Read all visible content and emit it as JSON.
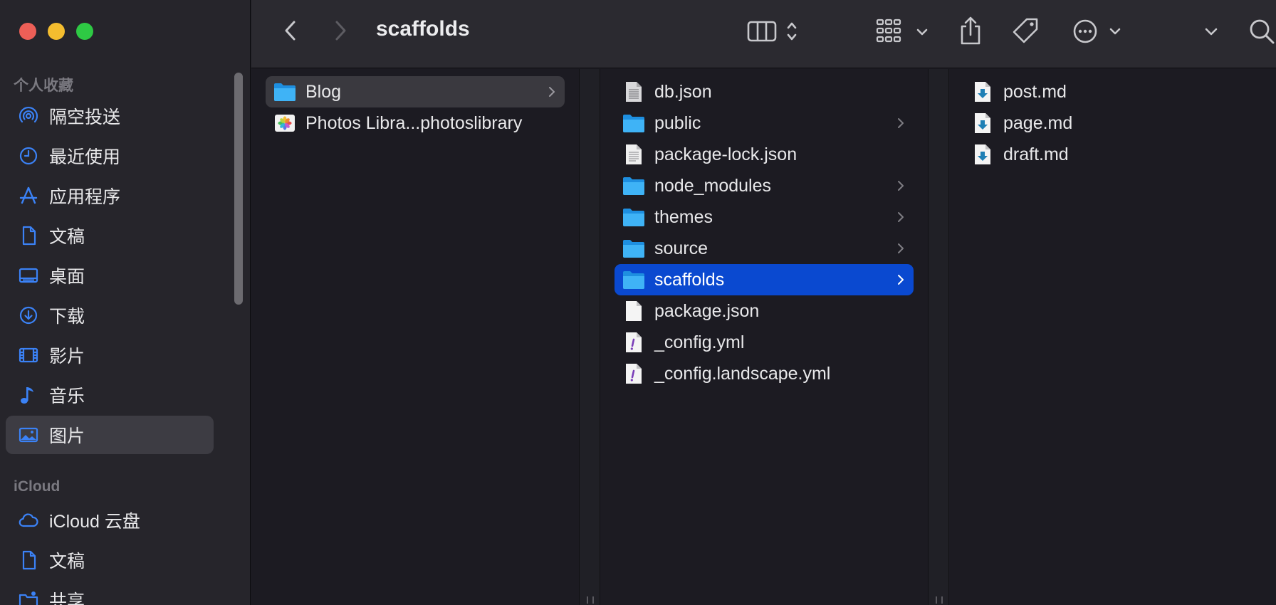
{
  "window": {
    "title": "scaffolds"
  },
  "sidebar": {
    "favorites_header": "个人收藏",
    "icloud_header": "iCloud",
    "favorites": [
      {
        "label": "隔空投送",
        "icon": "airdrop-icon"
      },
      {
        "label": "最近使用",
        "icon": "clock-icon"
      },
      {
        "label": "应用程序",
        "icon": "applications-icon"
      },
      {
        "label": "文稿",
        "icon": "document-icon"
      },
      {
        "label": "桌面",
        "icon": "desktop-icon"
      },
      {
        "label": "下载",
        "icon": "download-icon"
      },
      {
        "label": "影片",
        "icon": "film-icon"
      },
      {
        "label": "音乐",
        "icon": "music-icon"
      },
      {
        "label": "图片",
        "icon": "photo-icon",
        "selected": true
      }
    ],
    "icloud": [
      {
        "label": "iCloud 云盘",
        "icon": "cloud-icon"
      },
      {
        "label": "文稿",
        "icon": "document-icon"
      },
      {
        "label": "共享",
        "icon": "shared-folder-icon"
      }
    ]
  },
  "toolbar": {
    "back_icon": "chevron-left-icon",
    "forward_icon": "chevron-right-icon",
    "view_icon": "column-view-icon",
    "group_icon": "group-grid-icon",
    "share_icon": "share-icon",
    "tag_icon": "tag-icon",
    "more_icon": "more-icon",
    "search_icon": "search-icon"
  },
  "columns": [
    {
      "items": [
        {
          "label": "Blog",
          "kind": "folder",
          "has_children": true,
          "selected": "inactive"
        },
        {
          "label": "Photos Libra...photoslibrary",
          "kind": "photos-library",
          "has_children": false
        }
      ]
    },
    {
      "items": [
        {
          "label": "db.json",
          "kind": "file-json",
          "has_children": false
        },
        {
          "label": "public",
          "kind": "folder",
          "has_children": true
        },
        {
          "label": "package-lock.json",
          "kind": "file-doc",
          "has_children": false
        },
        {
          "label": "node_modules",
          "kind": "folder",
          "has_children": true
        },
        {
          "label": "themes",
          "kind": "folder",
          "has_children": true
        },
        {
          "label": "source",
          "kind": "folder",
          "has_children": true
        },
        {
          "label": "scaffolds",
          "kind": "folder",
          "has_children": true,
          "selected": "active"
        },
        {
          "label": "package.json",
          "kind": "file-blank",
          "has_children": false
        },
        {
          "label": "_config.yml",
          "kind": "file-yml",
          "has_children": false
        },
        {
          "label": "_config.landscape.yml",
          "kind": "file-yml",
          "has_children": false
        }
      ]
    },
    {
      "items": [
        {
          "label": "post.md",
          "kind": "file-md",
          "has_children": false
        },
        {
          "label": "page.md",
          "kind": "file-md",
          "has_children": false
        },
        {
          "label": "draft.md",
          "kind": "file-md",
          "has_children": false
        }
      ]
    }
  ]
}
